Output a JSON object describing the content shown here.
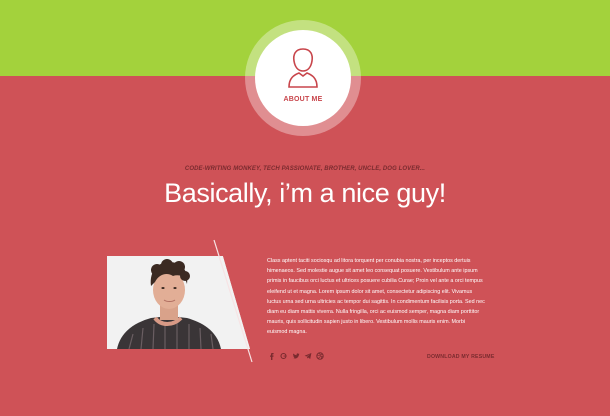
{
  "header": {
    "nav_label": "ABOUT ME",
    "nav_icon": "user-icon"
  },
  "hero": {
    "tagline": "CODE-WRITING MONKEY, TECH PASSIONATE, BROTHER, UNCLE, DOG LOVER...",
    "headline": "Basically, i’m a nice guy!"
  },
  "about": {
    "bio_lines": [
      "Class aptent taciti sociosqu ad litora torquent per conubia nostra, per inceptos dertuis",
      "himenaeos. Sed molestie augue sit amet leo consequat posuere. Vestibulum ante ipsum",
      "primis in faucibus orci luctus et ultrices posuere cubilia Curae; Proin vel ante a orci tempus",
      "eleifend ut et magna. Lorem ipsum dolor sit amet, consectetur adipiscing elit. Vivamus",
      "luctus urna sed urna ultricies ac tempor dui sagittis. In condimentum facilisis porta. Sed nec",
      "diam eu diam mattis viverra. Nulla fringilla, orci ac euismod semper, magna diam porttitor",
      "mauris, quis sollicitudin sapien justo in libero. Vestibulum mollis mauris enim. Morbi",
      "euismod magna."
    ],
    "resume_label": "DOWNLOAD MY RESUME",
    "social_icons": [
      "facebook-icon",
      "google-plus-icon",
      "twitter-icon",
      "telegram-icon",
      "dribbble-icon"
    ]
  },
  "colors": {
    "accent_green": "#a3d23c",
    "background_red": "#cf5257",
    "dark_text": "#7a2b2f"
  }
}
